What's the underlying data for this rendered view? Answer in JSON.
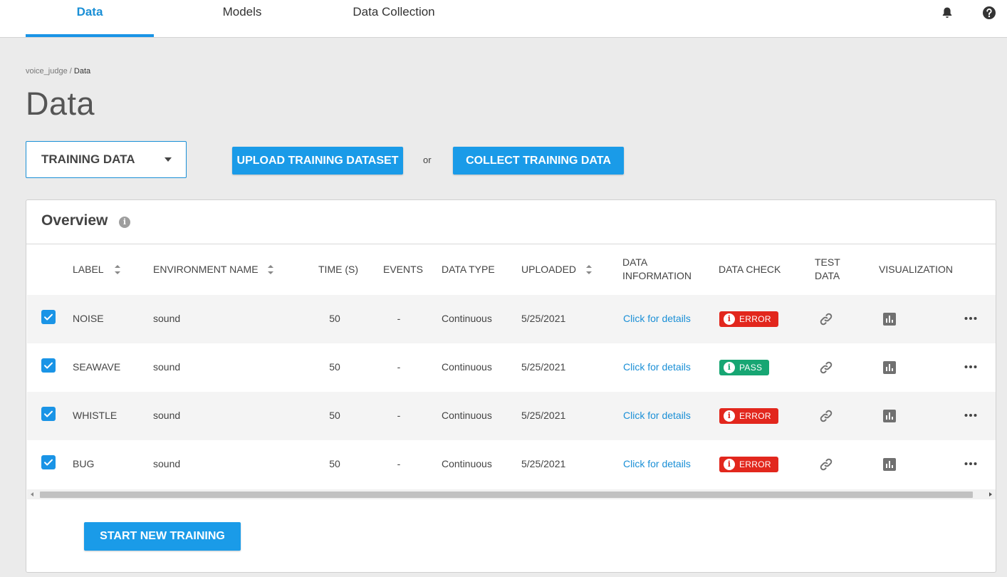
{
  "nav": {
    "tabs": [
      {
        "label": "Data",
        "active": true
      },
      {
        "label": "Models",
        "active": false
      },
      {
        "label": "Data Collection",
        "active": false
      }
    ],
    "icons": [
      "bell-icon",
      "help-icon"
    ]
  },
  "breadcrumb": {
    "project": "voice_judge",
    "separator": " / ",
    "current": "Data"
  },
  "page_title": "Data",
  "dataset_select": {
    "selected": "TRAINING DATA"
  },
  "actions": {
    "upload_label": "UPLOAD TRAINING DATASET",
    "or_label": "or",
    "collect_label": "COLLECT TRAINING DATA",
    "start_training_label": "START NEW TRAINING"
  },
  "overview": {
    "title": "Overview",
    "info_icon": "info-icon",
    "columns": {
      "label": "LABEL",
      "environment_name": "ENVIRONMENT NAME",
      "time": "TIME (S)",
      "events": "EVENTS",
      "data_type": "DATA TYPE",
      "uploaded": "UPLOADED",
      "data_information_1": "DATA",
      "data_information_2": "INFORMATION",
      "data_check": "DATA CHECK",
      "test_data_1": "TEST",
      "test_data_2": "DATA",
      "visualization": "VISUALIZATION"
    },
    "rows": [
      {
        "label": "NOISE",
        "environment": "sound",
        "time": "50",
        "events": "-",
        "data_type": "Continuous",
        "uploaded": "5/25/2021",
        "info": "Click for details",
        "check": "ERROR",
        "checked": true
      },
      {
        "label": "SEAWAVE",
        "environment": "sound",
        "time": "50",
        "events": "-",
        "data_type": "Continuous",
        "uploaded": "5/25/2021",
        "info": "Click for details",
        "check": "PASS",
        "checked": true
      },
      {
        "label": "WHISTLE",
        "environment": "sound",
        "time": "50",
        "events": "-",
        "data_type": "Continuous",
        "uploaded": "5/25/2021",
        "info": "Click for details",
        "check": "ERROR",
        "checked": true
      },
      {
        "label": "BUG",
        "environment": "sound",
        "time": "50",
        "events": "-",
        "data_type": "Continuous",
        "uploaded": "5/25/2021",
        "info": "Click for details",
        "check": "ERROR",
        "checked": true
      }
    ]
  },
  "colors": {
    "accent": "#1a94e6",
    "error": "#e2271d",
    "pass": "#17a673",
    "background": "#ebebeb"
  }
}
